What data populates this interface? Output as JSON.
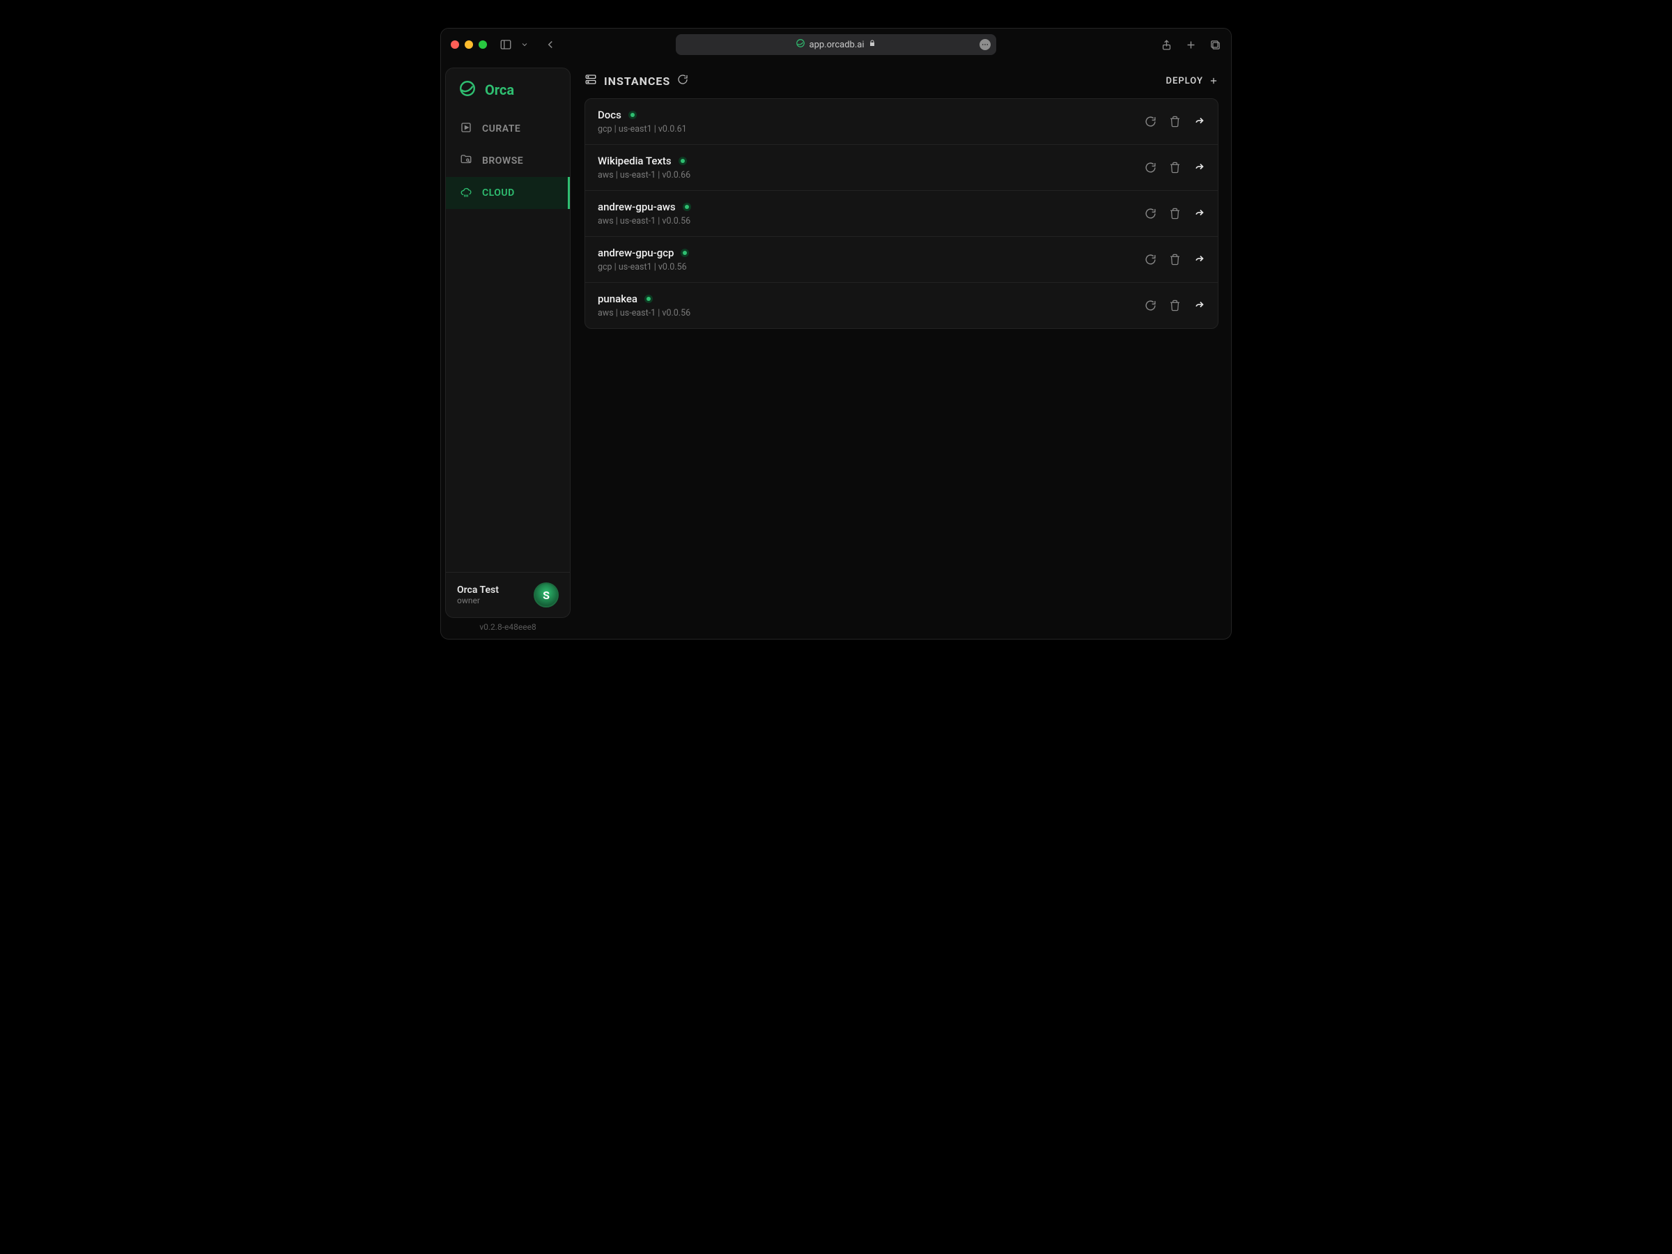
{
  "browser": {
    "url_text": "app.orcadb.ai"
  },
  "brand": {
    "name": "Orca"
  },
  "nav": {
    "items": [
      {
        "label": "CURATE",
        "icon": "curate",
        "active": false
      },
      {
        "label": "BROWSE",
        "icon": "browse",
        "active": false
      },
      {
        "label": "CLOUD",
        "icon": "cloud",
        "active": true
      }
    ]
  },
  "account": {
    "name": "Orca Test",
    "role": "owner",
    "avatar_initial": "S"
  },
  "build": "v0.2.8-e48eee8",
  "page": {
    "title": "INSTANCES",
    "deploy_label": "DEPLOY"
  },
  "instances": [
    {
      "name": "Docs",
      "provider": "gcp",
      "region": "us-east1",
      "version": "v0.0.61",
      "status": "running"
    },
    {
      "name": "Wikipedia Texts",
      "provider": "aws",
      "region": "us-east-1",
      "version": "v0.0.66",
      "status": "running"
    },
    {
      "name": "andrew-gpu-aws",
      "provider": "aws",
      "region": "us-east-1",
      "version": "v0.0.56",
      "status": "running"
    },
    {
      "name": "andrew-gpu-gcp",
      "provider": "gcp",
      "region": "us-east1",
      "version": "v0.0.56",
      "status": "running"
    },
    {
      "name": "punakea",
      "provider": "aws",
      "region": "us-east-1",
      "version": "v0.0.56",
      "status": "running"
    }
  ]
}
